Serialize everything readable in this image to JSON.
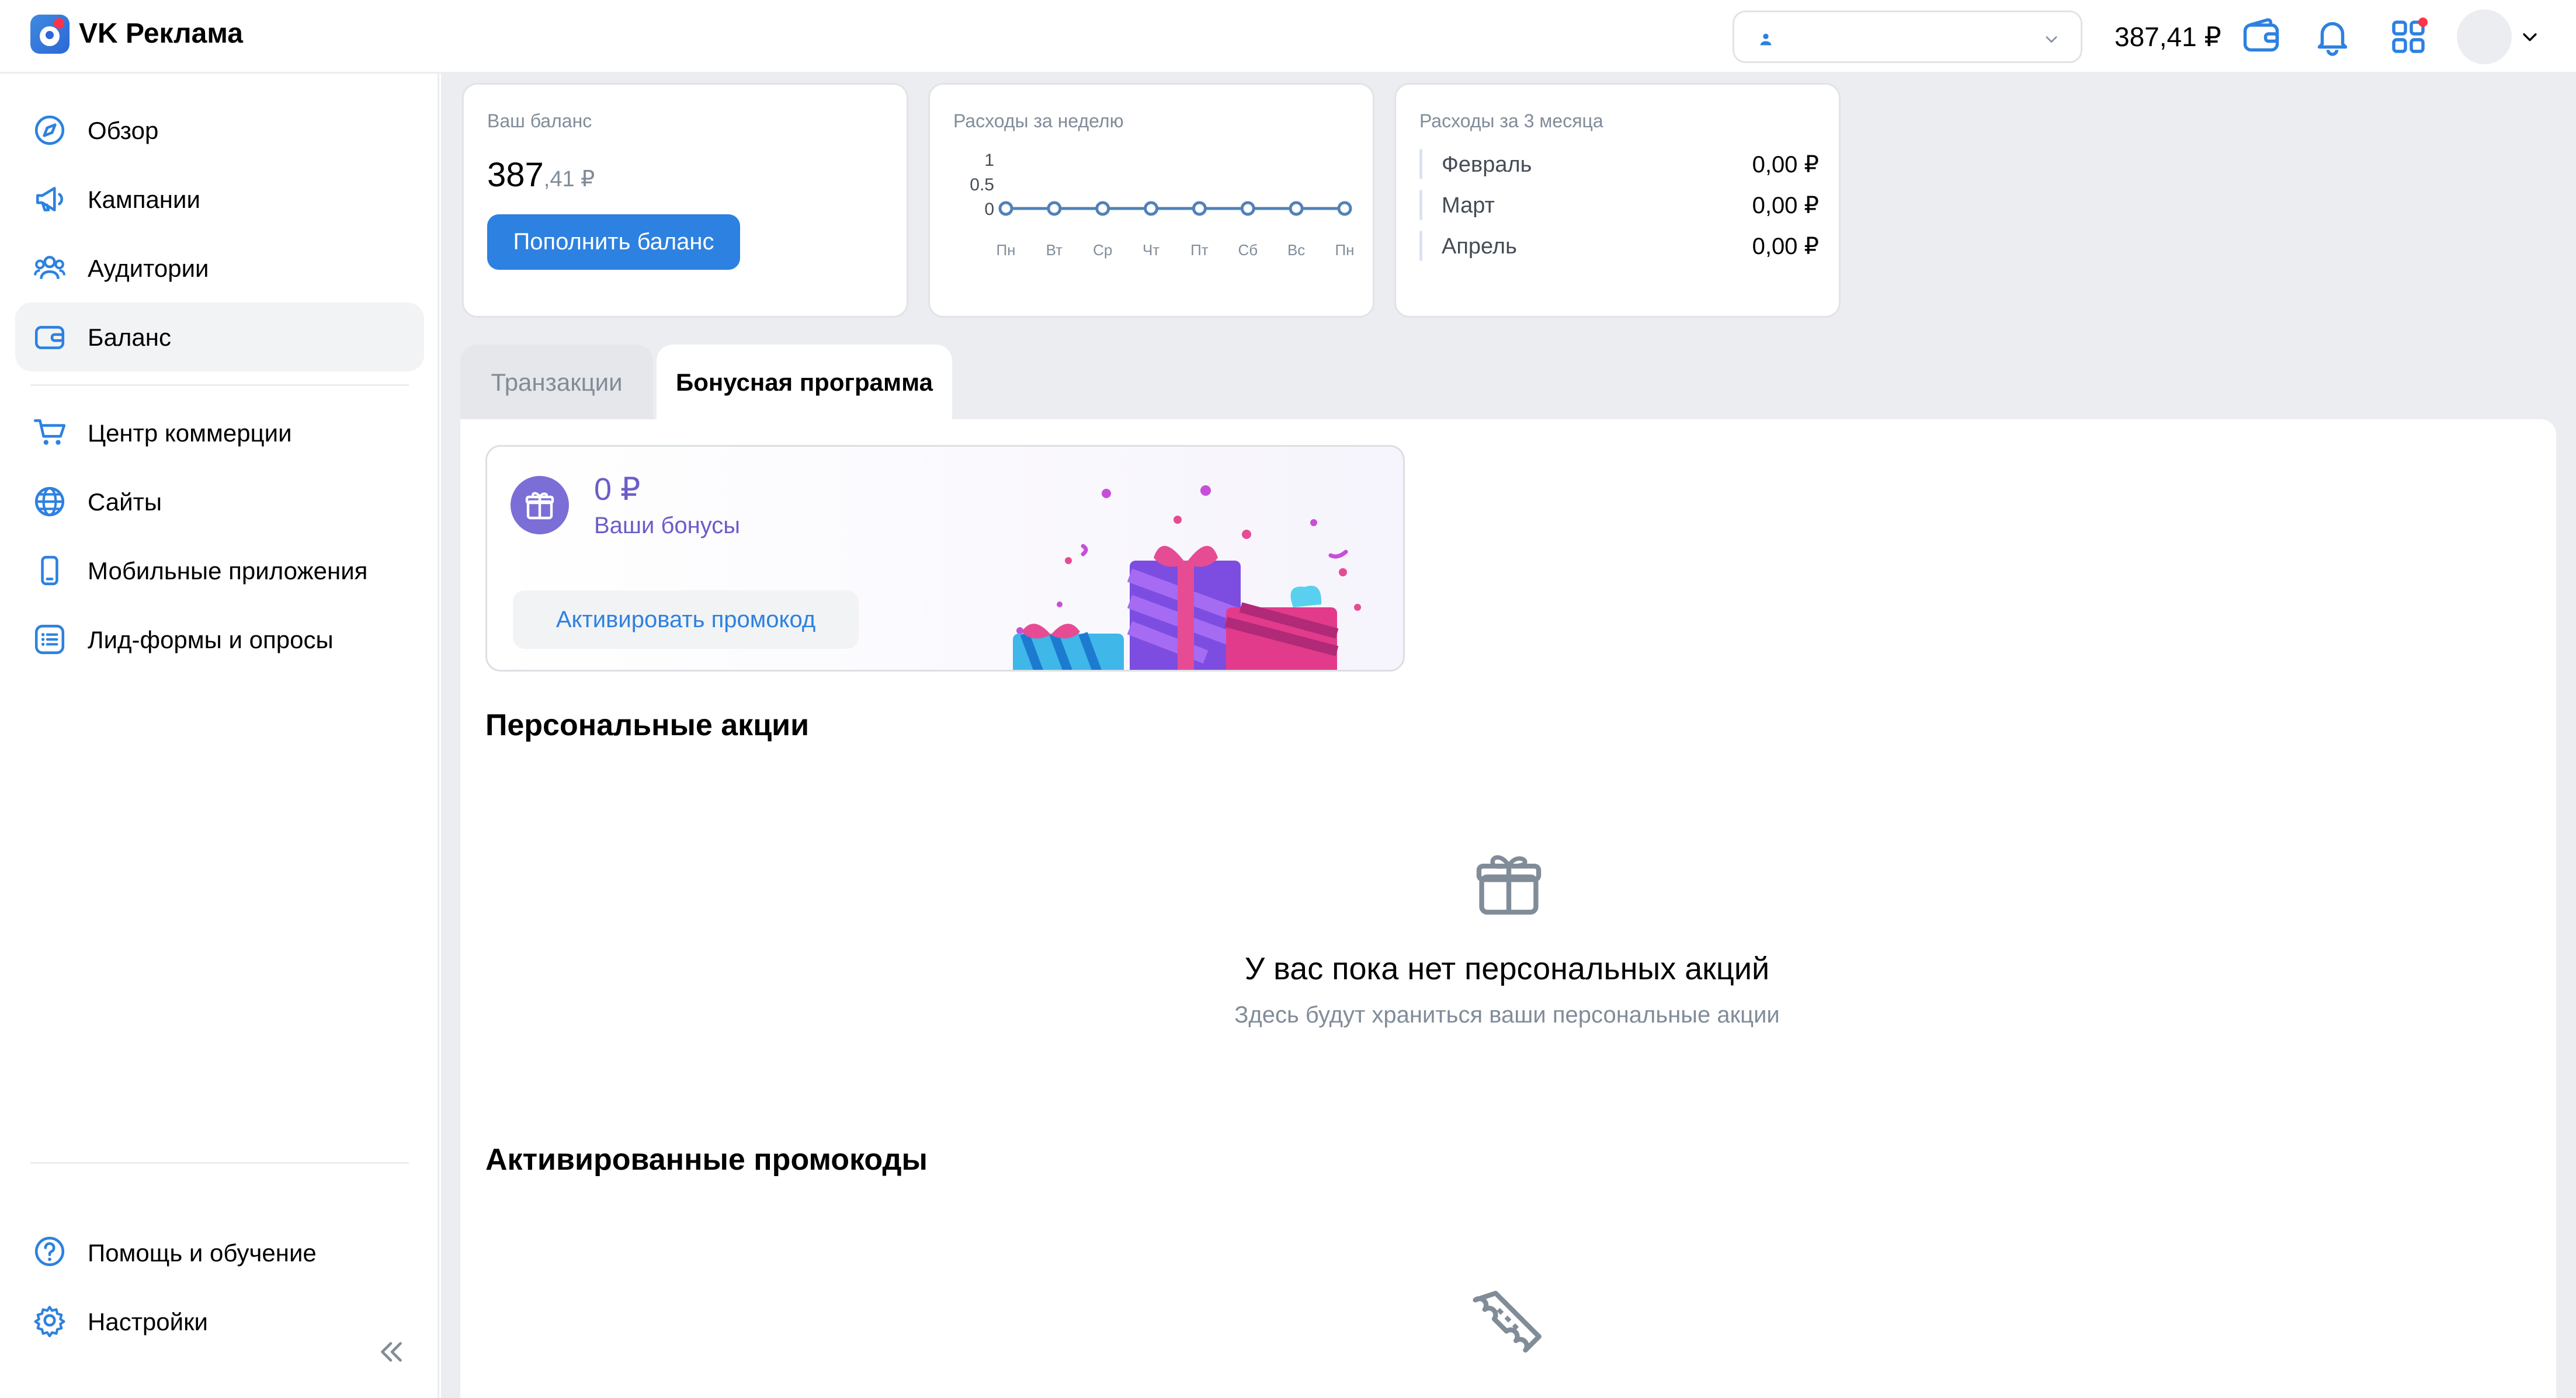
{
  "app": {
    "logo_text": "VK Реклама"
  },
  "topbar": {
    "account_name": "",
    "balance": "387,41 ₽",
    "icons": [
      "wallet-icon",
      "bell-icon",
      "apps-grid-icon",
      "chevron-down-icon"
    ],
    "notification_dot_color": "#ff3347"
  },
  "sidebar": {
    "items": [
      {
        "label": "Обзор",
        "icon": "compass-icon"
      },
      {
        "label": "Кампании",
        "icon": "megaphone-icon"
      },
      {
        "label": "Аудитории",
        "icon": "users-icon"
      },
      {
        "label": "Баланс",
        "icon": "wallet-icon",
        "active": true
      },
      {
        "label": "Центр коммерции",
        "icon": "cart-icon"
      },
      {
        "label": "Сайты",
        "icon": "globe-icon"
      },
      {
        "label": "Мобильные приложения",
        "icon": "smartphone-icon"
      },
      {
        "label": "Лид-формы и опросы",
        "icon": "list-icon"
      }
    ],
    "footer": [
      {
        "label": "Помощь и обучение",
        "icon": "help-icon"
      },
      {
        "label": "Настройки",
        "icon": "gear-icon"
      }
    ]
  },
  "balance_card": {
    "caption": "Ваш баланс",
    "int": "387",
    "dec": ",41 ₽",
    "topup_label": "Пополнить баланс"
  },
  "weekly_card": {
    "caption": "Расходы за неделю"
  },
  "chart_data": {
    "type": "line",
    "title": "",
    "categories": [
      "Пн",
      "Вт",
      "Ср",
      "Чт",
      "Пт",
      "Сб",
      "Вс",
      "Пн"
    ],
    "series": [
      {
        "values": [
          0,
          0,
          0,
          0,
          0,
          0,
          0,
          0
        ]
      }
    ],
    "ylim": [
      0,
      1
    ],
    "yticks": [
      "1",
      "0.5",
      "0"
    ],
    "color": "#5181b8",
    "grid": false
  },
  "months_card": {
    "caption": "Расходы за 3 месяца",
    "rows": [
      {
        "month": "Февраль",
        "value": "0,00 ₽"
      },
      {
        "month": "Март",
        "value": "0,00 ₽"
      },
      {
        "month": "Апрель",
        "value": "0,00 ₽"
      }
    ]
  },
  "tabs": [
    {
      "label": "Транзакции"
    },
    {
      "label": "Бонусная программа",
      "active": true
    }
  ],
  "bonus": {
    "value": "0 ₽",
    "label": "Ваши бонусы",
    "promo_button": "Активировать промокод",
    "accent_color": "#6a5ec8"
  },
  "personal": {
    "title": "Персональные акции",
    "empty_title": "У вас пока нет персональных акций",
    "empty_sub": "Здесь будут храниться ваши персональные акции"
  },
  "promocodes": {
    "title": "Активированные промокоды"
  }
}
